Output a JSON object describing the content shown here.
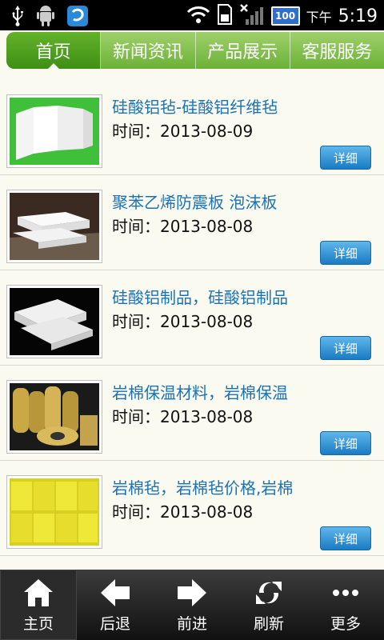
{
  "statusbar": {
    "time": "5:19",
    "ampm": "下午",
    "battery": "100",
    "icons": [
      "usb-icon",
      "android-icon",
      "app-icon",
      "wifi-icon",
      "sd-card-icon",
      "signal-icon"
    ]
  },
  "tabs": [
    {
      "label": "首页",
      "active": true
    },
    {
      "label": "新闻资讯",
      "active": false
    },
    {
      "label": "产品展示",
      "active": false
    },
    {
      "label": "客服服务",
      "active": false
    }
  ],
  "items": [
    {
      "title": "硅酸铝毡-硅酸铝纤维毡",
      "time": "时间：2013-08-09",
      "button": "详细",
      "thumb": "white-boards-on-green"
    },
    {
      "title": "聚苯乙烯防震板 泡沫板",
      "time": "时间：2013-08-08",
      "button": "详细",
      "thumb": "foam-boards"
    },
    {
      "title": "硅酸铝制品，硅酸铝制品",
      "time": "时间：2013-08-08",
      "button": "详细",
      "thumb": "fiber-blankets-on-black"
    },
    {
      "title": "岩棉保温材料，岩棉保温",
      "time": "时间：2013-08-08",
      "button": "详细",
      "thumb": "rock-wool-rolls"
    },
    {
      "title": "岩棉毡，岩棉毡价格,岩棉",
      "time": "时间：2013-08-08",
      "button": "详细",
      "thumb": "yellow-rock-wool-panels"
    }
  ],
  "bottom": [
    {
      "label": "主页",
      "icon": "home-icon",
      "active": true
    },
    {
      "label": "后退",
      "icon": "back-arrow-icon",
      "active": false
    },
    {
      "label": "前进",
      "icon": "forward-arrow-icon",
      "active": false
    },
    {
      "label": "刷新",
      "icon": "refresh-icon",
      "active": false
    },
    {
      "label": "更多",
      "icon": "more-icon",
      "active": false
    }
  ],
  "colors": {
    "tab_green": "#6bb138",
    "tab_active": "#3e8f15",
    "title_blue": "#1a73b6",
    "button_blue": "#1b7bc2"
  }
}
